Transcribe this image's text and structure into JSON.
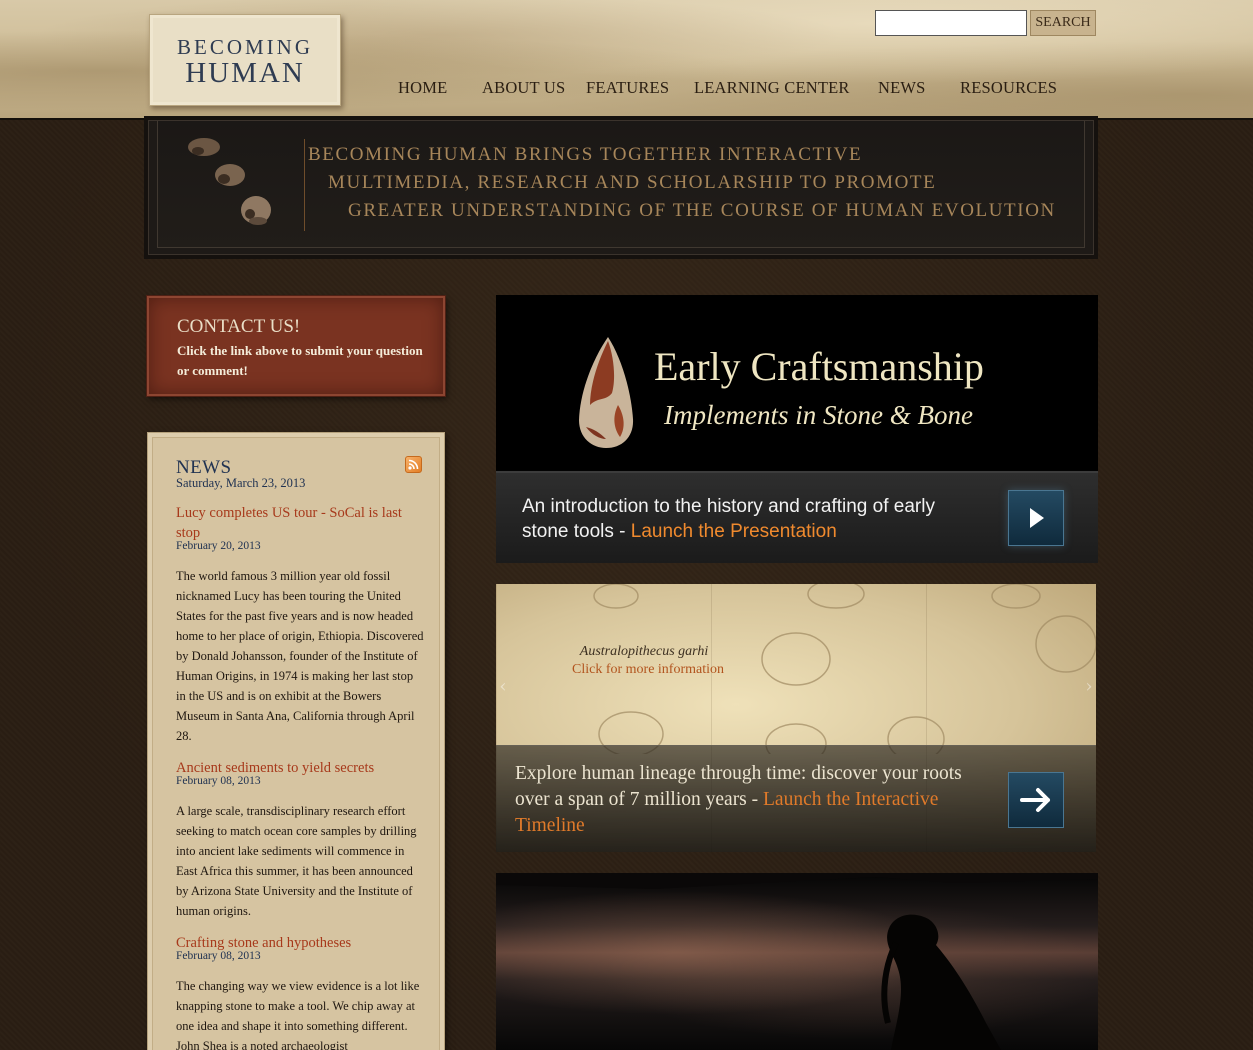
{
  "header": {
    "logo": {
      "line1": "BECOMING",
      "line2": "HUMAN"
    },
    "search": {
      "placeholder": "",
      "value": "",
      "button_label": "SEARCH"
    },
    "nav": [
      {
        "label": "HOME"
      },
      {
        "label": "ABOUT US"
      },
      {
        "label": "FEATURES"
      },
      {
        "label": "LEARNING CENTER"
      },
      {
        "label": "NEWS"
      },
      {
        "label": "RESOURCES"
      }
    ]
  },
  "banner": {
    "lines": [
      "BECOMING HUMAN BRINGS TOGETHER INTERACTIVE",
      "MULTIMEDIA, RESEARCH AND SCHOLARSHIP TO PROMOTE",
      "GREATER UNDERSTANDING OF THE COURSE OF HUMAN EVOLUTION"
    ]
  },
  "contact": {
    "title": "CONTACT US!",
    "text": "Click the link above to submit your question or comment!"
  },
  "news": {
    "title": "NEWS",
    "date": "Saturday, March 23, 2013",
    "items": [
      {
        "headline": "Lucy completes US tour - SoCal is last stop",
        "date": "February 20, 2013",
        "body": "The world famous 3 million year old fossil nicknamed Lucy has been touring the United States for the past five years and is now headed home to her place of origin, Ethiopia. Discovered by Donald Johansson, founder of the Institute of Human Origins, in 1974 is making her last stop in the US and is on exhibit at the Bowers Museum in Santa Ana, California through April 28."
      },
      {
        "headline": "Ancient sediments to yield secrets",
        "date": "February 08, 2013",
        "body": "A large scale, transdisciplinary research effort seeking to match ocean core samples by drilling into ancient lake sediments will commence in East Africa this summer, it has been announced by Arizona State University and the Institute of human origins."
      },
      {
        "headline": "Crafting stone and hypotheses",
        "date": "February 08, 2013",
        "body": "The changing way we view evidence is a lot like knapping stone to make a tool. We chip away at one idea and shape it into something different. John Shea is a noted archaeologist"
      }
    ]
  },
  "features": {
    "craftsmanship": {
      "title": "Early Craftsmanship",
      "subtitle": "Implements in Stone & Bone",
      "desc": "An introduction to the history and crafting of early stone tools - ",
      "link": "Launch the Presentation"
    },
    "timeline": {
      "species": "Australopithecus garhi",
      "click": "Click for more information",
      "desc": "Explore human lineage through time: discover your roots over a span of 7 million years  - ",
      "link": "Launch the Interactive Timeline"
    }
  },
  "colors": {
    "header_bg": "#d8c9a8",
    "banner_text": "#a7865a",
    "contact_bg": "#7a3321",
    "news_bg": "#d6c4a1",
    "headline": "#a7391b",
    "link_orange": "#f08a2e"
  },
  "icons": {
    "rss": "rss-icon",
    "play": "play-icon",
    "arrow": "arrow-right-icon"
  }
}
